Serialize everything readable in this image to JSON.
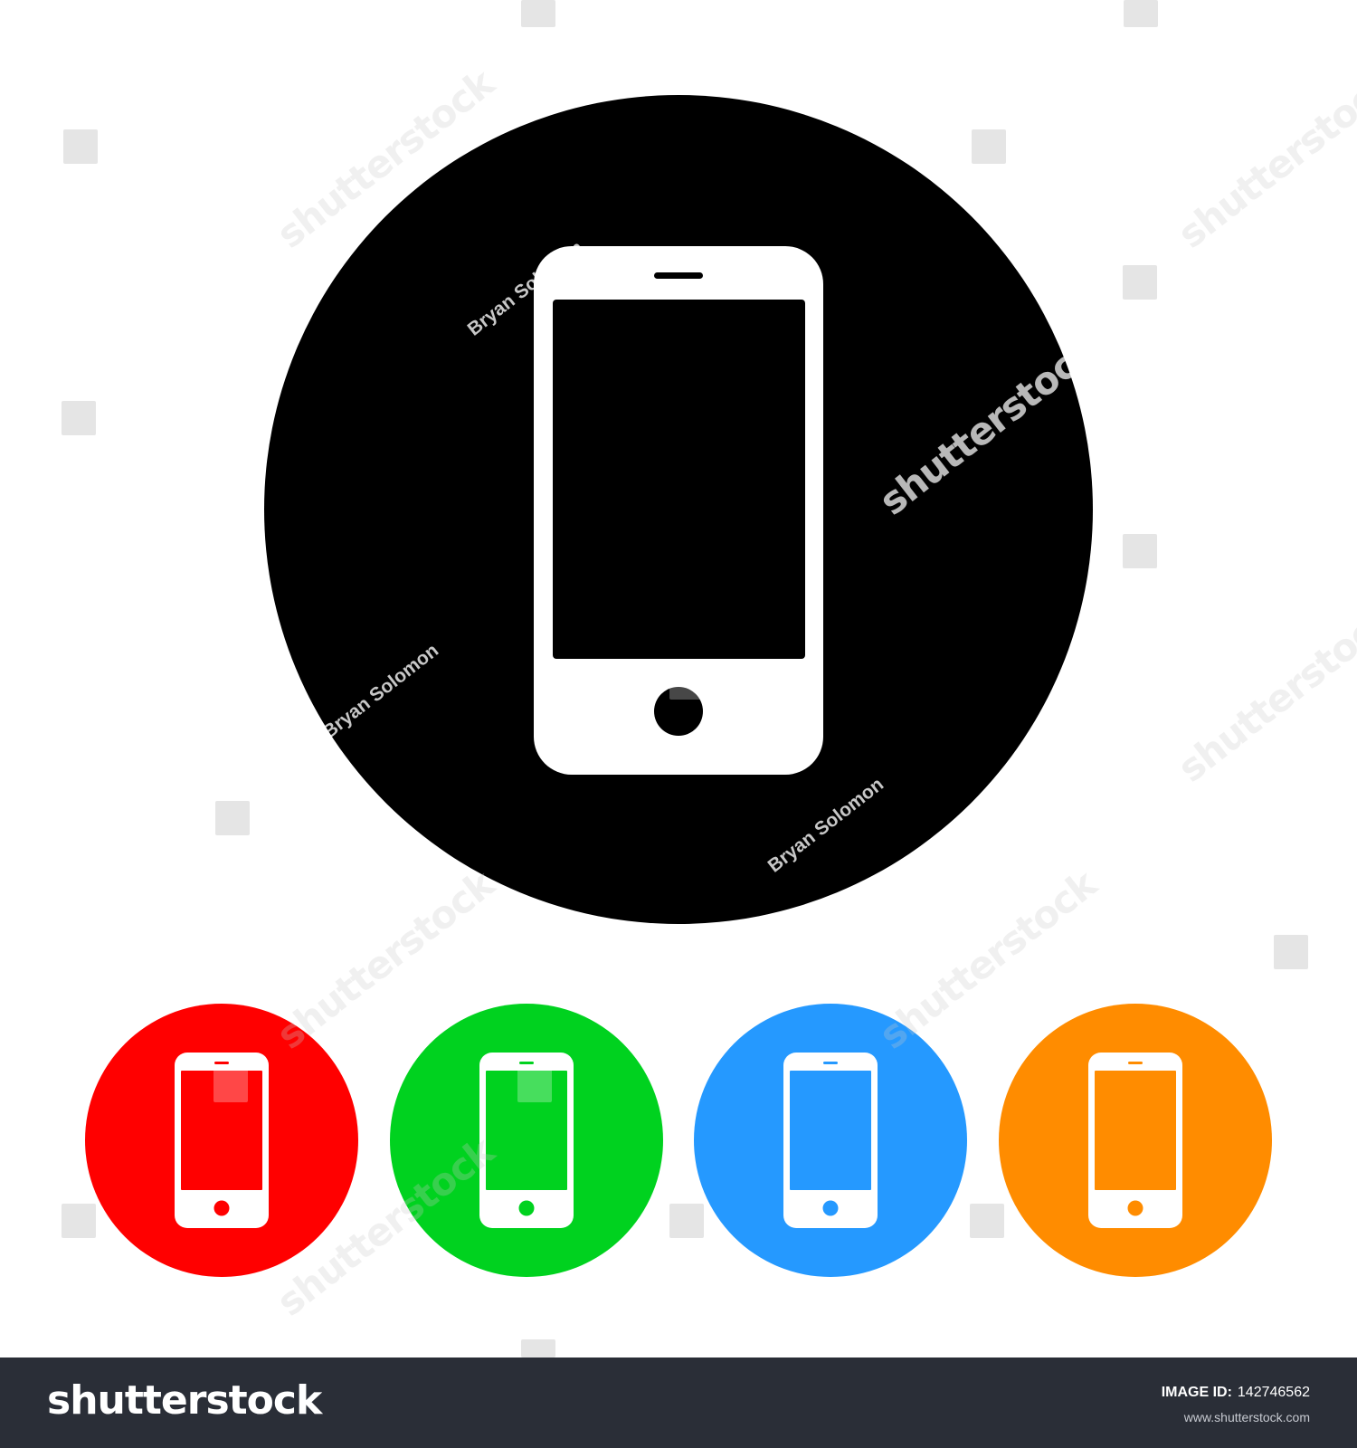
{
  "colors": {
    "background": "#ffffff",
    "main_circle": "#000000",
    "phone_body": "#ffffff",
    "red": "#ff0000",
    "green": "#00d21f",
    "blue": "#2599ff",
    "orange": "#ff8c00",
    "footer_bg": "#2a2e37"
  },
  "icons": {
    "main": "smartphone-icon",
    "variants": [
      {
        "name": "red",
        "color": "#ff0000",
        "icon": "smartphone-icon"
      },
      {
        "name": "green",
        "color": "#00d21f",
        "icon": "smartphone-icon"
      },
      {
        "name": "blue",
        "color": "#2599ff",
        "icon": "smartphone-icon"
      },
      {
        "name": "orange",
        "color": "#ff8c00",
        "icon": "smartphone-icon"
      }
    ]
  },
  "watermark": {
    "author": "Bryan Solomon",
    "logo": "shutterstock"
  },
  "footer": {
    "logo": "shutterstock",
    "image_id_label": "IMAGE ID:",
    "image_id_value": "142746562",
    "url": "www.shutterstock.com"
  }
}
